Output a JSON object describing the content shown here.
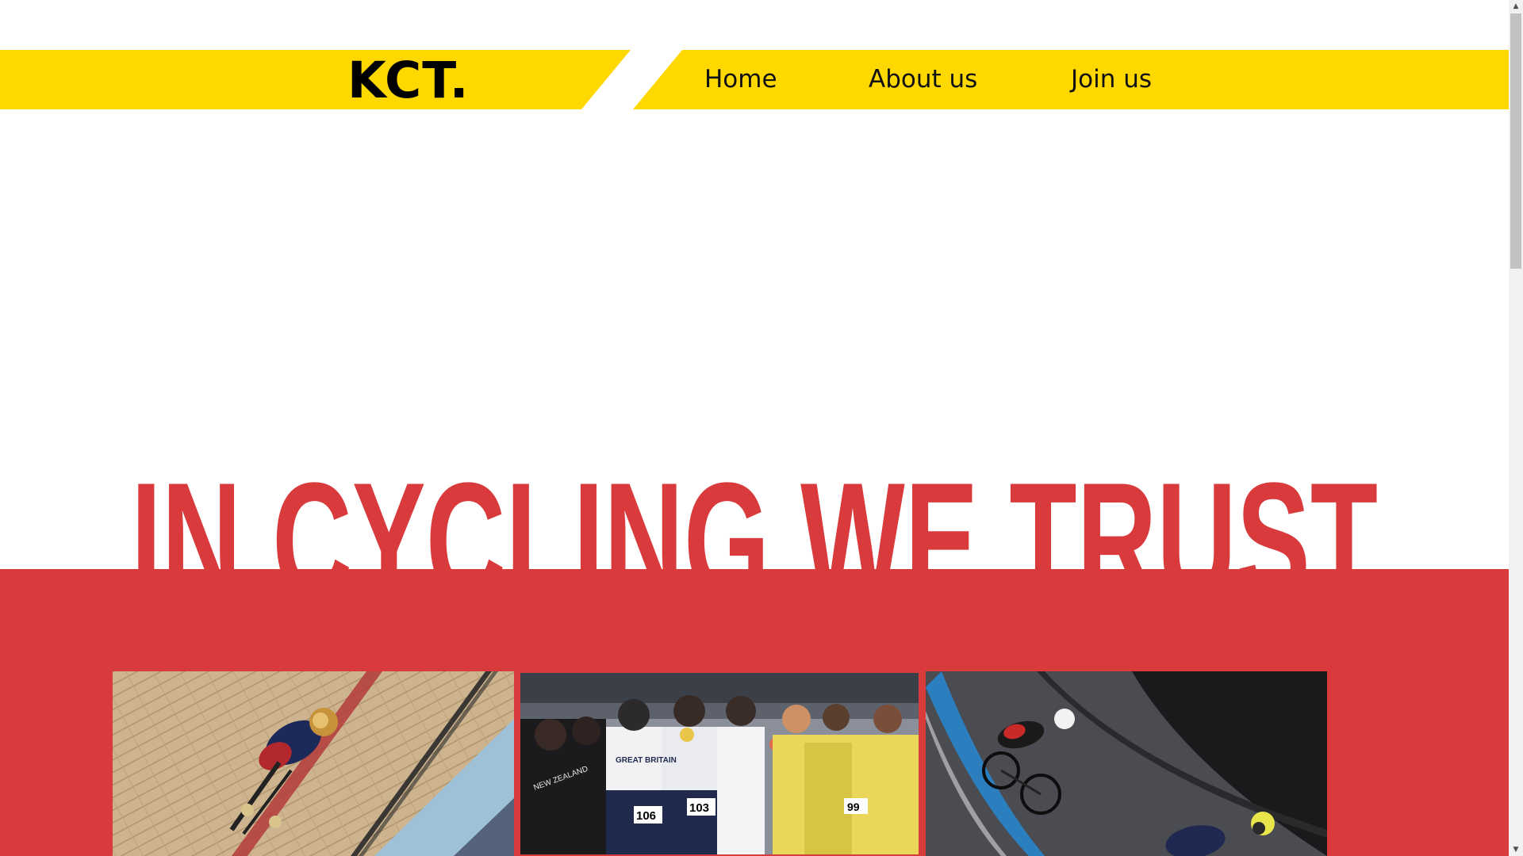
{
  "brand": {
    "logo_text": "KCT."
  },
  "nav": {
    "home_label": "Home",
    "about_label": "About us",
    "join_label": "Join us"
  },
  "hero": {
    "title": "IN CYCLING WE TRUST"
  },
  "gallery": {
    "photos": [
      {
        "name": "track-cyclist-photo"
      },
      {
        "name": "team-celebration-photo"
      },
      {
        "name": "velodrome-race-photo"
      }
    ],
    "jersey_text": {
      "great_britain": "GREAT BRITAIN",
      "new_zealand": "NEW ZEALAND",
      "bib_1": "106",
      "bib_2": "103",
      "bib_3": "99"
    }
  },
  "colors": {
    "header_yellow": "#ffd800",
    "hero_red": "#d93b3d",
    "text_black": "#000000",
    "background": "#ffffff"
  },
  "scrollbar": {
    "up_icon": "scroll-up-arrow-icon",
    "down_icon": "scroll-down-arrow-icon"
  }
}
